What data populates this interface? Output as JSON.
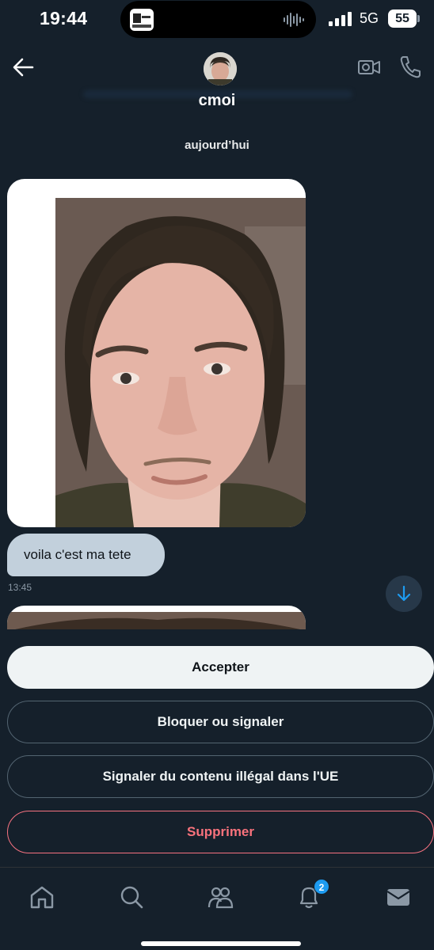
{
  "status_bar": {
    "time": "19:44",
    "network": "5G",
    "battery": "55"
  },
  "header": {
    "contact_name": "cmoi",
    "back_icon": "arrow-left-icon",
    "video_icon": "video-camera-icon",
    "call_icon": "phone-icon"
  },
  "conversation": {
    "date_separator": "aujourd’hui",
    "messages": [
      {
        "type": "image",
        "description_icon": "photo-attachment"
      },
      {
        "type": "text",
        "text": "voila c'est ma tete",
        "time": "13:45"
      }
    ]
  },
  "request_actions": {
    "accept_label": "Accepter",
    "block_label": "Bloquer ou signaler",
    "report_eu_label": "Signaler du contenu illégal dans l'UE",
    "delete_label": "Supprimer"
  },
  "bottom_nav": {
    "items": [
      {
        "icon": "home-icon"
      },
      {
        "icon": "search-icon"
      },
      {
        "icon": "communities-icon"
      },
      {
        "icon": "notifications-icon",
        "badge": "2"
      },
      {
        "icon": "messages-icon"
      }
    ]
  },
  "colors": {
    "background": "#15202b",
    "accent": "#1d9bf0",
    "danger": "#f4212e",
    "bubble": "#c2d0dc"
  }
}
